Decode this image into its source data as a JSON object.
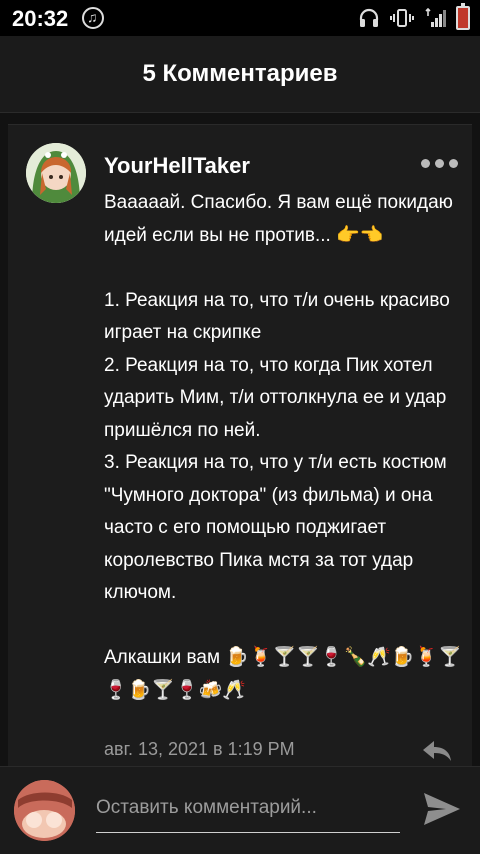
{
  "status_bar": {
    "time": "20:32",
    "icons": [
      "music-icon",
      "headphones-icon",
      "vibrate-icon",
      "signal-icon",
      "battery-icon"
    ]
  },
  "header": {
    "title": "5 Комментариев"
  },
  "comment": {
    "username": "YourHellTaker",
    "text": "Вааааай. Спасибо. Я вам ещё покидаю идей если вы не против... 👉👈\n\n1. Реакция на то, что т/и очень красиво играет на скрипке\n2. Реакция на то, что когда Пик хотел ударить Мим, т/и оттолкнула ее и удар пришёлся по ней.\n3. Реакция на то, что у т/и есть костюм \"Чумного доктора\" (из фильма) и она часто с его помощью поджигает королевство Пика мстя за тот удар ключом.\n\nАлкашки вам 🍺🍹🍸🍸🍷🍾🥂🍺🍹🍸🍷🍺🍸🍷🍻🥂",
    "date": "авг. 13, 2021 в 1:19 PM"
  },
  "composer": {
    "placeholder": "Оставить комментарий..."
  },
  "colors": {
    "background": "#121212",
    "card": "#1c1c1c",
    "text": "#ffffff",
    "muted": "#9a9a9a"
  }
}
